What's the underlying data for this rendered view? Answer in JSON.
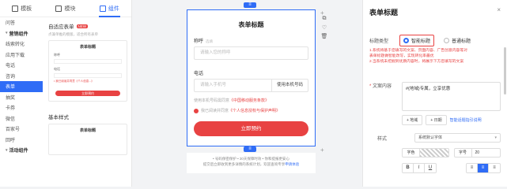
{
  "left": {
    "tabs": [
      {
        "label": "模板",
        "icon": "template-icon"
      },
      {
        "label": "模块",
        "icon": "module-icon"
      },
      {
        "label": "组件",
        "icon": "component-icon"
      }
    ],
    "categories": [
      {
        "label": "问答",
        "group": false
      },
      {
        "label": "营销组件",
        "group": true
      },
      {
        "label": "线索转化",
        "group": false
      },
      {
        "label": "应用下载",
        "group": false
      },
      {
        "label": "电话",
        "group": false
      },
      {
        "label": "咨询",
        "group": false
      },
      {
        "label": "表单",
        "group": false,
        "active": true
      },
      {
        "label": "抽奖",
        "group": false
      },
      {
        "label": "卡券",
        "group": false
      },
      {
        "label": "微信",
        "group": false
      },
      {
        "label": "百家号",
        "group": false
      },
      {
        "label": "回呼",
        "group": false
      },
      {
        "label": "活动组件",
        "group": true
      }
    ],
    "adaptive_form": {
      "title": "自适应表单",
      "badge": "NEW",
      "desc": "点兼单推的模版，适合所有表单",
      "mini_title": "表单标题",
      "mini_label1": "称呼",
      "mini_label2": "电话",
      "mini_note": "• 我已阅读并同意《个人信息...》",
      "mini_btn": "立即预约"
    },
    "basic_title": "基本样式",
    "basic_mini_title": "表单标题"
  },
  "canvas": {
    "handle_icon": "≡",
    "form_title": "表单标题",
    "name_label": "称呼",
    "name_sub": "选填",
    "name_placeholder": "请输入您的称呼",
    "phone_label": "电话",
    "phone_placeholder": "请输入手机号",
    "phone_link": "使用本机号码",
    "phone_note_prefix": "使用本机号码需同意",
    "phone_note_link": "《中国移动服务条款》",
    "agree_prefix": "我已阅读并同意",
    "agree_link": "《个人信息授权与保护声明》",
    "submit": "立即预约",
    "footer_line1": "• 号码保密保护   • 30天保障时效   • 你和提报更安心",
    "footer_line2": "提交后立即收到更多详情的系统计划，欢迎查询专享",
    "footer_link": "申请体验",
    "tools": [
      "+",
      "⧉",
      "♡",
      "🗑"
    ]
  },
  "right": {
    "title": "表单标题",
    "close": "×",
    "type_label": "标题类型",
    "radio_smart": "智能标题",
    "radio_normal": "普通标题",
    "notes": [
      "1.系统将基于您填写的文案、页面内容、广告创意内容等对",
      "表单标题做智能改写，实现转化率最优",
      "2.当系统未挖掘到优质内容时，将展示下方您填写的文案"
    ],
    "content_label": "文案内容",
    "content_value": "#{地域}专属，立享优惠",
    "btn_region": "+ 地域",
    "btn_date": "+ 日期",
    "smart_link": "智能话题指引说明",
    "style_label": "样式",
    "font_select": "系统默认字体",
    "color_key": "字色",
    "size_key": "字号",
    "size_value": "20",
    "fmt_bold": "B",
    "fmt_italic": "I",
    "fmt_underline": "U",
    "align_left": "≡",
    "align_center": "≡",
    "align_right": "≡"
  }
}
